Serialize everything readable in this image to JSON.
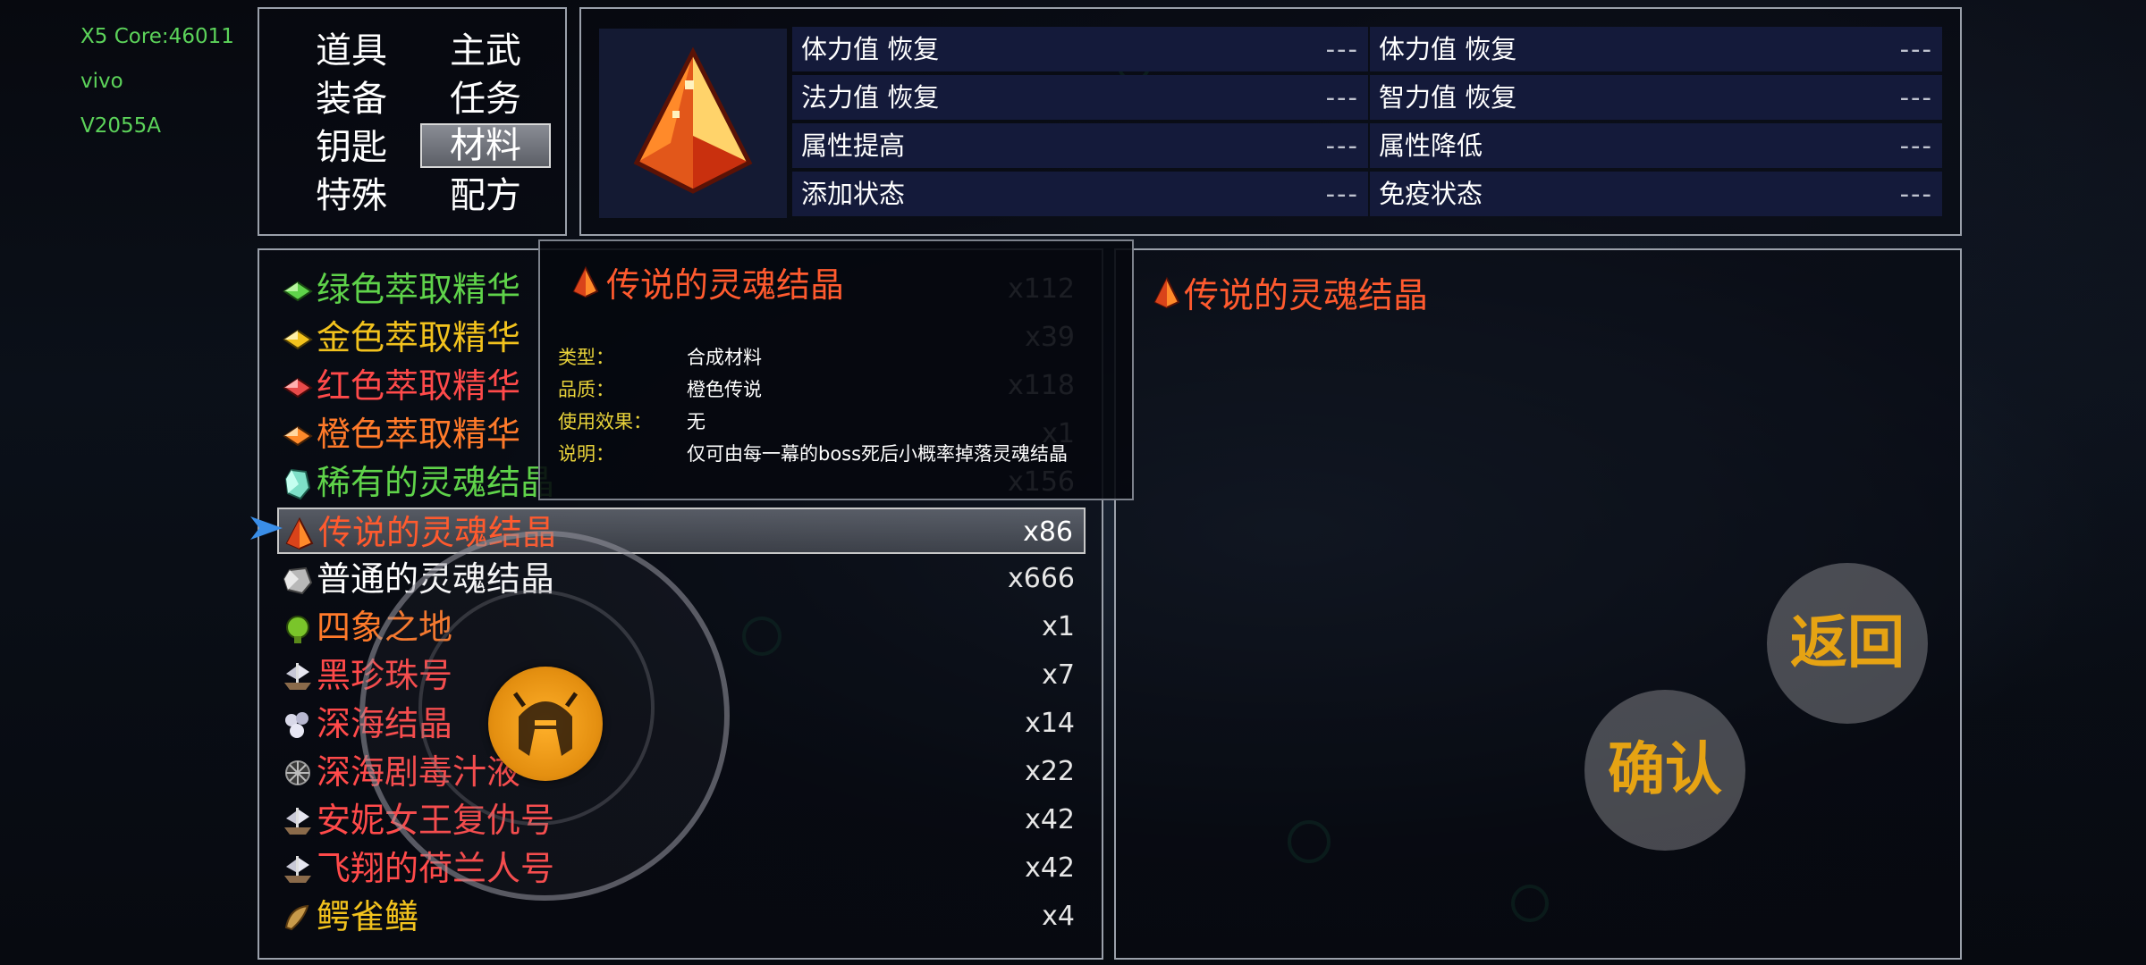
{
  "debug": {
    "line1": "X5 Core:46011",
    "line2": "vivo",
    "line3": "V2055A"
  },
  "categories": [
    {
      "label": "道具"
    },
    {
      "label": "主武"
    },
    {
      "label": "装备"
    },
    {
      "label": "任务"
    },
    {
      "label": "钥匙"
    },
    {
      "label": "材料"
    },
    {
      "label": "特殊"
    },
    {
      "label": "配方"
    }
  ],
  "selected_category": "材料",
  "stats": [
    {
      "label": "体力值 恢复",
      "value": "---"
    },
    {
      "label": "体力值 恢复",
      "value": "---"
    },
    {
      "label": "法力值 恢复",
      "value": "---"
    },
    {
      "label": "智力值 恢复",
      "value": "---"
    },
    {
      "label": "属性提高",
      "value": "---"
    },
    {
      "label": "属性降低",
      "value": "---"
    },
    {
      "label": "添加状态",
      "value": "---"
    },
    {
      "label": "免疫状态",
      "value": "---"
    }
  ],
  "items": [
    {
      "name": "绿色萃取精华",
      "qty": "x112",
      "color": "#5fd34a",
      "icon": "green-essence-icon"
    },
    {
      "name": "金色萃取精华",
      "qty": "x39",
      "color": "#f2c21d",
      "icon": "gold-essence-icon"
    },
    {
      "name": "红色萃取精华",
      "qty": "x118",
      "color": "#ff4a4a",
      "icon": "red-essence-icon"
    },
    {
      "name": "橙色萃取精华",
      "qty": "x1",
      "color": "#ff7a2a",
      "icon": "orange-essence-icon"
    },
    {
      "name": "稀有的灵魂结晶",
      "qty": "x156",
      "color": "#5fd34a",
      "icon": "rare-crystal-icon"
    },
    {
      "name": "传说的灵魂结晶",
      "qty": "x86",
      "color": "#ff5a2e",
      "icon": "legend-crystal-icon"
    },
    {
      "name": "普通的灵魂结晶",
      "qty": "x666",
      "color": "#ffffff",
      "icon": "common-crystal-icon"
    },
    {
      "name": "四象之地",
      "qty": "x1",
      "color": "#ff7a2a",
      "icon": "four-lands-icon"
    },
    {
      "name": "黑珍珠号",
      "qty": "x7",
      "color": "#ff4a4a",
      "icon": "ship-icon"
    },
    {
      "name": "深海结晶",
      "qty": "x14",
      "color": "#ff4a4a",
      "icon": "deep-sea-crystal-icon"
    },
    {
      "name": "深海剧毒汁液",
      "qty": "x22",
      "color": "#ff4a4a",
      "icon": "venom-icon"
    },
    {
      "name": "安妮女王复仇号",
      "qty": "x42",
      "color": "#ff4a4a",
      "icon": "ship-icon"
    },
    {
      "name": "飞翔的荷兰人号",
      "qty": "x42",
      "color": "#ff4a4a",
      "icon": "ship-icon"
    },
    {
      "name": "鳄雀鳝",
      "qty": "x4",
      "color": "#f2c21d",
      "icon": "fish-icon"
    }
  ],
  "selected_item_index": 5,
  "detail": {
    "title": "传说的灵魂结晶"
  },
  "tooltip": {
    "title": "传说的灵魂结晶",
    "rows": [
      {
        "label": "类型：",
        "value": "合成材料"
      },
      {
        "label": "品质：",
        "value": "橙色传说"
      },
      {
        "label": "使用效果：",
        "value": "无"
      },
      {
        "label": "说明：",
        "value": "仅可由每一幕的boss死后小概率掉落灵魂结晶"
      }
    ]
  },
  "buttons": {
    "back": "返回",
    "confirm": "确认"
  },
  "colors": {
    "accent_orange": "#ff5a2e",
    "label_yellow": "#e8d23a",
    "button_text": "#e6a313"
  }
}
